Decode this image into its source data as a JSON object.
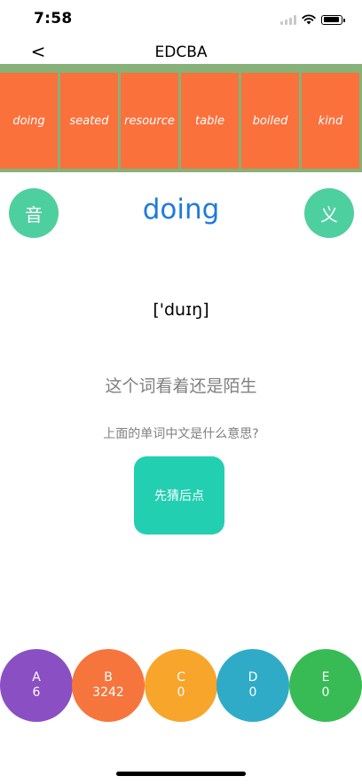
{
  "status_bar": {
    "time": "7:58"
  },
  "nav": {
    "back_label": "<",
    "title": "EDCBA"
  },
  "word_strip": [
    "doing",
    "seated",
    "resource",
    "table",
    "boiled",
    "kind"
  ],
  "card": {
    "sound_label": "音",
    "meaning_label": "义",
    "word": "doing",
    "phonetic": "['duɪŋ]",
    "stranger_text": "这个词看着还是陌生",
    "question": "上面的单词中文是什么意思?",
    "guess_label": "先猜后点"
  },
  "options": [
    {
      "letter": "A",
      "count": "6",
      "color": "#8b4fc4"
    },
    {
      "letter": "B",
      "count": "3242",
      "color": "#f6753c"
    },
    {
      "letter": "C",
      "count": "0",
      "color": "#f8a52b"
    },
    {
      "letter": "D",
      "count": "0",
      "color": "#2fabc7"
    },
    {
      "letter": "E",
      "count": "0",
      "color": "#38bb55"
    }
  ],
  "colors": {
    "word_tile": "#fb713c",
    "strip_background": "#86b179",
    "round_button": "#4ecf9f",
    "guess_button": "#23cfb1",
    "word_text": "#1f7ae0"
  }
}
